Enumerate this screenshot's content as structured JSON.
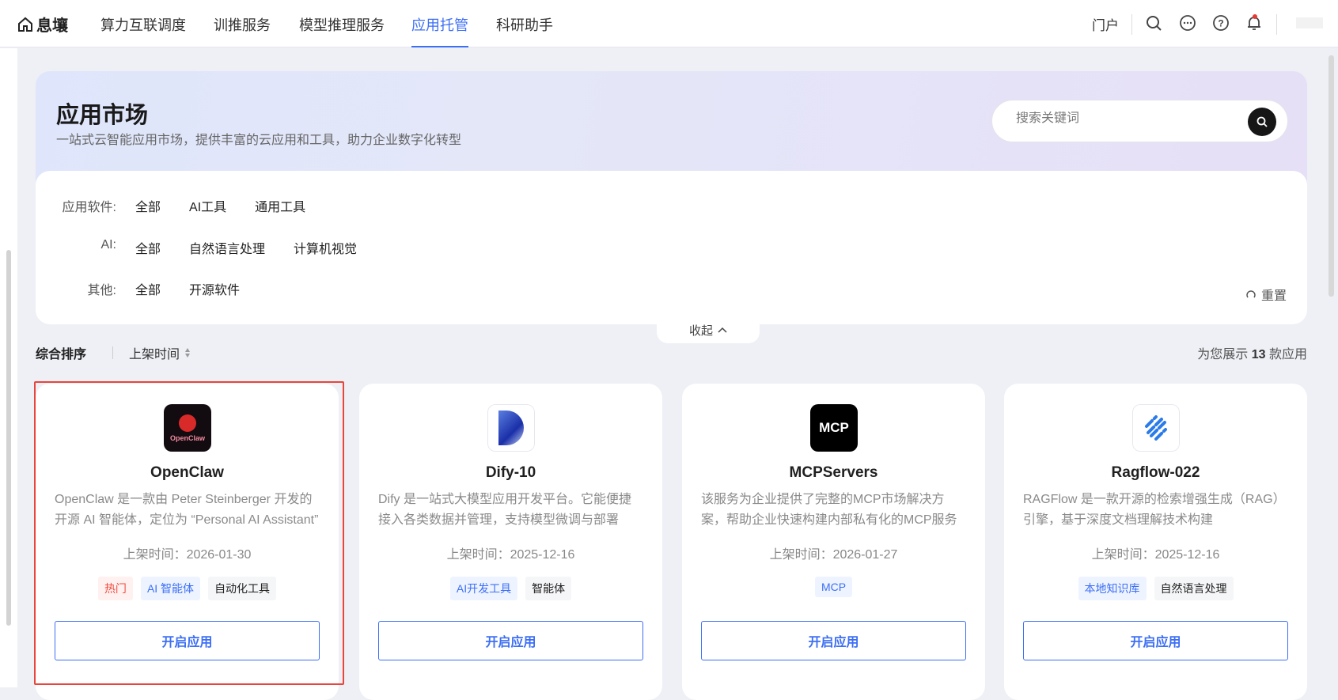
{
  "nav": {
    "brand": "息壤",
    "items": [
      "算力互联调度",
      "训推服务",
      "模型推理服务",
      "应用托管",
      "科研助手"
    ],
    "active": 3,
    "portal": "门户"
  },
  "banner": {
    "title": "应用市场",
    "subtitle": "一站式云智能应用市场，提供丰富的云应用和工具，助力企业数字化转型",
    "search_placeholder": "搜索关键词"
  },
  "filters": [
    {
      "label": "应用软件:",
      "items": [
        "全部",
        "AI工具",
        "通用工具"
      ]
    },
    {
      "label": "AI:",
      "items": [
        "全部",
        "自然语言处理",
        "计算机视觉"
      ]
    },
    {
      "label": "其他:",
      "items": [
        "全部",
        "开源软件"
      ]
    }
  ],
  "reset": "重置",
  "collapse": "收起",
  "sort": {
    "primary": "综合排序",
    "secondary": "上架时间",
    "count_prefix": "为您展示",
    "count": "13",
    "count_suffix": "款应用"
  },
  "cards": [
    {
      "name": "OpenClaw",
      "desc": "OpenClaw 是一款由 Peter Steinberger 开发的开源 AI 智能体，定位为 “Personal AI Assistant”",
      "date": "上架时间：2026-01-30",
      "tags": [
        {
          "t": "热门",
          "c": "red"
        },
        {
          "t": "AI 智能体",
          "c": "blue"
        },
        {
          "t": "自动化工具",
          "c": "gray"
        }
      ],
      "button": "开启应用",
      "icon_text": "OpenClaw"
    },
    {
      "name": "Dify-10",
      "desc": "Dify 是一站式大模型应用开发平台。它能便捷接入各类数据并管理，支持模型微调与部署",
      "date": "上架时间：2025-12-16",
      "tags": [
        {
          "t": "AI开发工具",
          "c": "blue"
        },
        {
          "t": "智能体",
          "c": "gray"
        }
      ],
      "button": "开启应用"
    },
    {
      "name": "MCPServers",
      "desc": "该服务为企业提供了完整的MCP市场解决方案，帮助企业快速构建内部私有化的MCP服务",
      "date": "上架时间：2026-01-27",
      "tags": [
        {
          "t": "MCP",
          "c": "blue"
        }
      ],
      "button": "开启应用",
      "icon_text": "MCP"
    },
    {
      "name": "Ragflow-022",
      "desc": "RAGFlow 是一款开源的检索增强生成（RAG）引擎，基于深度文档理解技术构建",
      "date": "上架时间：2025-12-16",
      "tags": [
        {
          "t": "本地知识库",
          "c": "blue"
        },
        {
          "t": "自然语言处理",
          "c": "gray"
        }
      ],
      "button": "开启应用"
    }
  ]
}
